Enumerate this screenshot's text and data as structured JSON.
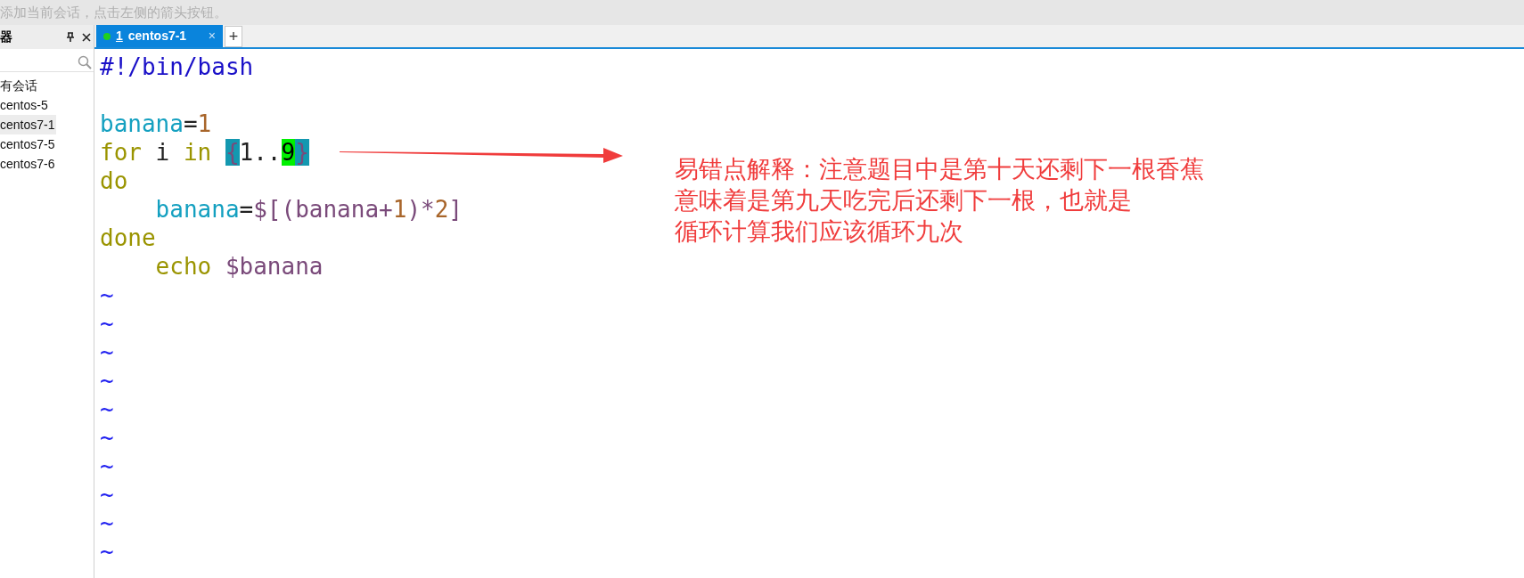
{
  "hint_bar": {
    "text": "添加当前会话，点击左侧的箭头按钮。"
  },
  "session_panel": {
    "title": "器",
    "items": [
      {
        "label": "有会话",
        "selected": false
      },
      {
        "label": "centos-5",
        "selected": false
      },
      {
        "label": "centos7-1",
        "selected": true
      },
      {
        "label": "centos7-5",
        "selected": false
      },
      {
        "label": "centos7-6",
        "selected": false
      }
    ]
  },
  "tabs": [
    {
      "number": "1",
      "label": "centos7-1",
      "selected": true,
      "connected": true,
      "close": "×"
    }
  ],
  "new_tab": "+",
  "editor": {
    "lines": [
      {
        "tokens": [
          {
            "text": "#!/bin/bash",
            "kind": "shebang"
          }
        ]
      },
      {
        "blank_before": true,
        "tokens": [
          {
            "text": "banana",
            "kind": "variable"
          },
          {
            "text": "=",
            "kind": "plain"
          },
          {
            "text": "1",
            "kind": "number"
          }
        ]
      },
      {
        "tokens": [
          {
            "text": "for",
            "kind": "keyword"
          },
          {
            "text": " i ",
            "kind": "plain"
          },
          {
            "text": "in ",
            "kind": "keyword"
          },
          {
            "text": "{",
            "kind": "brace-match"
          },
          {
            "text": "1..",
            "kind": "plain"
          },
          {
            "text": "9",
            "kind": "cursor"
          },
          {
            "text": "}",
            "kind": "brace-match"
          }
        ]
      },
      {
        "tokens": [
          {
            "text": "do",
            "kind": "keyword"
          }
        ]
      },
      {
        "indented": true,
        "tokens": [
          {
            "text": "banana",
            "kind": "variable"
          },
          {
            "text": "=",
            "kind": "plain"
          },
          {
            "text": "$[(banana+",
            "kind": "punct"
          },
          {
            "text": "1",
            "kind": "number"
          },
          {
            "text": ")*",
            "kind": "punct"
          },
          {
            "text": "2",
            "kind": "number"
          },
          {
            "text": "]",
            "kind": "punct"
          }
        ]
      },
      {
        "tokens": [
          {
            "text": "done",
            "kind": "keyword"
          }
        ]
      },
      {
        "indented": true,
        "tokens": [
          {
            "text": "echo ",
            "kind": "keyword"
          },
          {
            "text": "$banana",
            "kind": "punct"
          }
        ]
      }
    ],
    "empty_lines": [
      "~",
      "~",
      "~",
      "~",
      "~",
      "~",
      "~",
      "~",
      "~",
      "~"
    ]
  },
  "annotation": {
    "lines": [
      "易错点解释：注意题目中是第十天还剩下一根香蕉",
      "意味着是第九天吃完后还剩下一根，也就是",
      "循环计算我们应该循环九次"
    ]
  }
}
